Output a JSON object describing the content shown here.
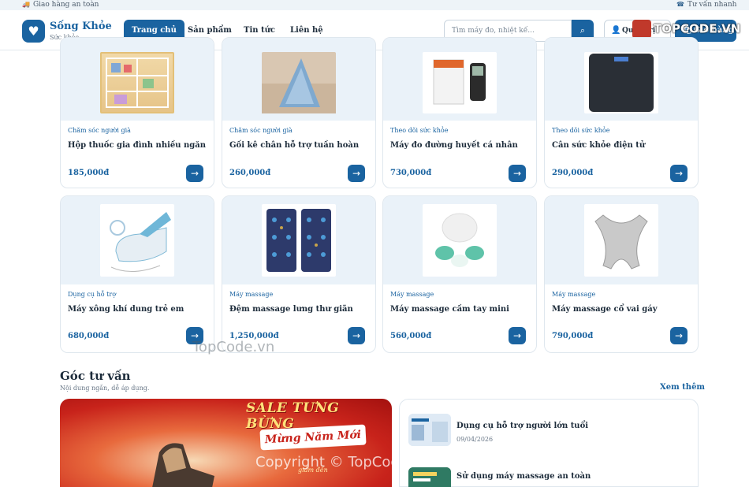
{
  "topbar": {
    "left_text": "Giao hàng an toàn",
    "right_text": "Tư vấn nhanh"
  },
  "brand": {
    "name": "Sống Khỏe",
    "tagline": "Sức khỏe"
  },
  "nav": {
    "items": [
      {
        "label": "Trang chủ",
        "active": true
      },
      {
        "label": "Sản phẩm",
        "active": false
      },
      {
        "label": "Tin tức",
        "active": false
      },
      {
        "label": "Liên hệ",
        "active": false
      }
    ]
  },
  "search": {
    "placeholder": "Tìm máy đo, nhiệt kế..."
  },
  "header_actions": {
    "admin_label": "Quản trị viên",
    "cart_label": "Giỏ hàng"
  },
  "products": [
    {
      "category": "Chăm sóc người già",
      "name": "Hộp thuốc gia đình nhiều ngăn",
      "price": "185,000đ"
    },
    {
      "category": "Chăm sóc người già",
      "name": "Gối kê chân hỗ trợ tuần hoàn",
      "price": "260,000đ"
    },
    {
      "category": "Theo dõi sức khỏe",
      "name": "Máy đo đường huyết cá nhân",
      "price": "730,000đ"
    },
    {
      "category": "Theo dõi sức khỏe",
      "name": "Cân sức khỏe điện tử",
      "price": "290,000đ"
    },
    {
      "category": "Dụng cụ hỗ trợ",
      "name": "Máy xông khí dung trẻ em",
      "price": "680,000đ"
    },
    {
      "category": "Máy massage",
      "name": "Đệm massage lưng thư giãn",
      "price": "1,250,000đ"
    },
    {
      "category": "Máy massage",
      "name": "Máy massage cầm tay mini",
      "price": "560,000đ"
    },
    {
      "category": "Máy massage",
      "name": "Máy massage cổ vai gáy",
      "price": "790,000đ"
    }
  ],
  "advice": {
    "title": "Góc tư vấn",
    "subtitle": "Nội dung ngắn, dễ áp dụng.",
    "see_more": "Xem thêm",
    "banner": {
      "headline": "SALE TƯNG BỪNG",
      "ribbon": "Mừng Năm Mới",
      "small": "giảm đến"
    },
    "articles": [
      {
        "title": "Dụng cụ hỗ trợ người lớn tuổi",
        "date": "09/04/2026"
      },
      {
        "title": "Sử dụng máy massage an toàn",
        "date": ""
      }
    ]
  },
  "watermarks": {
    "logo": "TOPCODE.VN",
    "mid": "TopCode.vn",
    "copyright": "Copyright © TopCode.vn"
  },
  "colors": {
    "primary": "#1a63a0",
    "image_bg": "#eaf2f9",
    "text": "#1c2b3a"
  }
}
